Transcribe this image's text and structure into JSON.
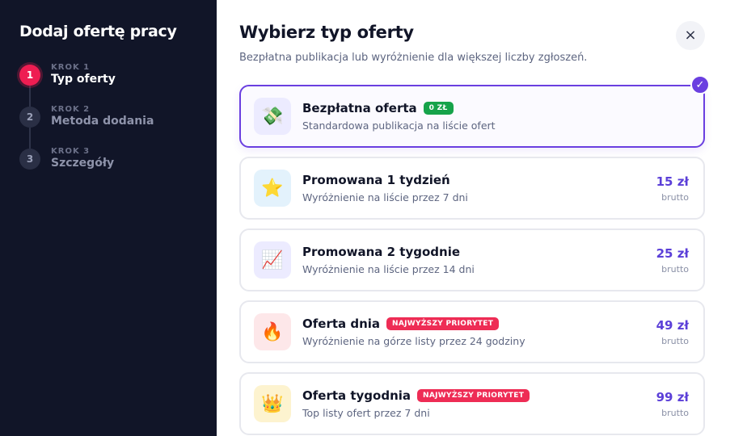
{
  "sidebar": {
    "title": "Dodaj ofertę pracy",
    "steps": [
      {
        "number": "1",
        "kicker": "KROK 1",
        "label": "Typ oferty"
      },
      {
        "number": "2",
        "kicker": "KROK 2",
        "label": "Metoda dodania"
      },
      {
        "number": "3",
        "kicker": "KROK 3",
        "label": "Szczegóły"
      }
    ]
  },
  "main": {
    "title": "Wybierz typ oferty",
    "subtitle": "Bezpłatna publikacja lub wyróżnienie dla większej liczby zgłoszeń.",
    "close_icon": "×",
    "selected_check": "✓",
    "options": [
      {
        "icon": "💸",
        "title": "Bezpłatna oferta",
        "badge": "0 ZŁ",
        "desc": "Standardowa publikacja na liście ofert",
        "price": "",
        "price_unit": ""
      },
      {
        "icon": "⭐",
        "title": "Promowana 1 tydzień",
        "badge": "",
        "desc": "Wyróżnienie na liście przez 7 dni",
        "price": "15 zł",
        "price_unit": "brutto"
      },
      {
        "icon": "📈",
        "title": "Promowana 2 tygodnie",
        "badge": "",
        "desc": "Wyróżnienie na liście przez 14 dni",
        "price": "25 zł",
        "price_unit": "brutto"
      },
      {
        "icon": "🔥",
        "title": "Oferta dnia",
        "badge": "NAJWYŻSZY PRIORYTET",
        "desc": "Wyróżnienie na górze listy przez 24 godziny",
        "price": "49 zł",
        "price_unit": "brutto"
      },
      {
        "icon": "👑",
        "title": "Oferta tygodnia",
        "badge": "NAJWYŻSZY PRIORYTET",
        "desc": "Top listy ofert przez 7 dni",
        "price": "99 zł",
        "price_unit": "brutto"
      }
    ]
  },
  "colors": {
    "accent": "#6a3fe0",
    "step_active": "#ee1d52",
    "badge_free": "#16a34a",
    "badge_priority": "#ee2c55",
    "sidebar_bg": "#111528"
  }
}
